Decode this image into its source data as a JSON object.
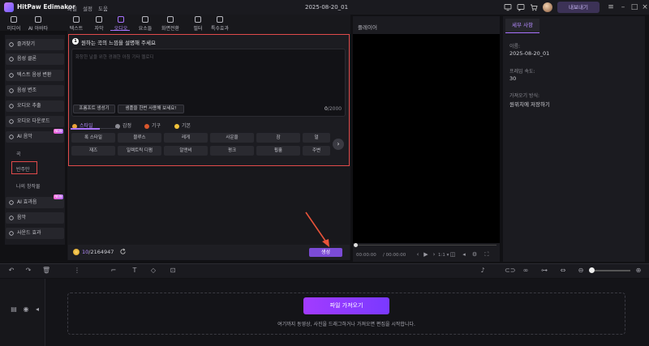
{
  "app": {
    "name": "HitPaw Edimakor",
    "menu": [
      "파일",
      "설정",
      "도움"
    ],
    "project_title": "2025-08-20_01",
    "export_label": "내보내기"
  },
  "toolbar": {
    "tools": [
      {
        "label": "미디어",
        "icon": "media-icon"
      },
      {
        "label": "AI 아바타",
        "icon": "ai-avatar-icon"
      },
      {
        "label": "텍스트",
        "icon": "text-icon"
      },
      {
        "label": "자막",
        "icon": "subtitle-icon"
      },
      {
        "label": "오디오",
        "icon": "audio-icon"
      },
      {
        "label": "요소들",
        "icon": "elements-icon"
      },
      {
        "label": "화면전환",
        "icon": "transition-icon"
      },
      {
        "label": "필터",
        "icon": "filter-icon"
      },
      {
        "label": "특수효과",
        "icon": "effects-icon"
      }
    ],
    "active_index": 4
  },
  "sidebar": {
    "items": [
      {
        "label": "즐겨찾기",
        "icon": "star-icon"
      },
      {
        "label": "음성 클론",
        "icon": "voice-clone-icon"
      },
      {
        "label": "텍스트 음성 변환",
        "icon": "tts-icon"
      },
      {
        "label": "음성 변조",
        "icon": "voice-change-icon"
      },
      {
        "label": "오디오 추출",
        "icon": "mic-icon"
      },
      {
        "label": "오디오 다운로드",
        "icon": "download-icon"
      },
      {
        "label": "AI 음악",
        "icon": "ai-music-icon",
        "badge": "NEW"
      }
    ],
    "ai_music_sub": [
      "곡",
      "반주만",
      "나의 창작물"
    ],
    "selected_sub": "반주만",
    "lower_items": [
      {
        "label": "AI 효과음",
        "icon": "ai-sfx-icon",
        "badge": "NEW"
      },
      {
        "label": "음악",
        "icon": "music-icon"
      },
      {
        "label": "사운드 효과",
        "icon": "sound-effect-icon"
      }
    ]
  },
  "music_panel": {
    "step": "1",
    "heading": "원하는 곡의 느낌을 설명해 주세요",
    "placeholder": "화창한 날을 위한 경쾌한 아침 기타 멜로디",
    "prompt_generator_label": "프롬프트 생성기",
    "use_all_label": "샘플을 한번 사용해 보세요!",
    "char_count": "0",
    "char_max": "/2000",
    "categories": [
      {
        "label": "스타일",
        "color": "#e9a23b"
      },
      {
        "label": "감정",
        "color": "#8c8c94"
      },
      {
        "label": "기구",
        "color": "#d8562c"
      },
      {
        "label": "기본",
        "color": "#f0c23a"
      }
    ],
    "active_category": 0,
    "tags": [
      [
        "록 스타일",
        "블루스",
        "레게",
        "사운울",
        "잠",
        "얼"
      ],
      [
        "재즈",
        "일렉트릭 디펌",
        "알앤비",
        "펑크",
        "훵훌",
        "주변"
      ]
    ]
  },
  "credits": {
    "used": "10",
    "total": "/2164947"
  },
  "generate_label": "생성",
  "player": {
    "label": "플레이어",
    "time_current": "00:00:00",
    "time_total": "/ 00:00:00",
    "ratio": "1:1"
  },
  "details": {
    "tab": "세부 사항",
    "fields": [
      {
        "label": "이름:",
        "value": "2025-08-20_01"
      },
      {
        "label": "프레임 속도:",
        "value": "30"
      },
      {
        "label": "가져오기 방식:",
        "value": "원위치에 저장하기"
      }
    ]
  },
  "timeline": {
    "import_label": "파일 가져오기",
    "hint": "여기까지 동영상, 사진을 드래그하거나 가져오면 편집을 시작합니다."
  },
  "colors": {
    "accent": "#a972ff",
    "highlight_box": "#e14a4a",
    "annotation_arrow": "#e8533a"
  }
}
